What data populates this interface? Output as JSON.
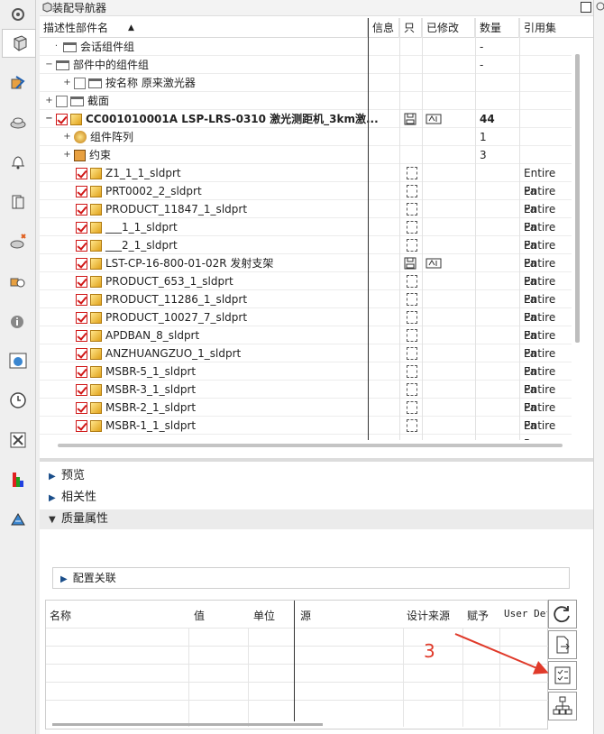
{
  "panel": {
    "title": "装配导航器"
  },
  "columns": {
    "name": "描述性部件名",
    "info": "信息",
    "readonly": "只",
    "modified": "已修改",
    "qty": "数量",
    "refset": "引用集"
  },
  "tree": [
    {
      "label": "会话组件组",
      "qty": "-"
    },
    {
      "label": "部件中的组件组",
      "qty": "-"
    },
    {
      "label": "按名称 原来激光器"
    },
    {
      "label": "截面"
    },
    {
      "label": "CC001010001A  LSP-LRS-0310  激光测距机_3km激...",
      "qty": "44"
    },
    {
      "label": "组件阵列",
      "qty": "1"
    },
    {
      "label": "约束",
      "qty": "3"
    },
    {
      "label": "Z1_1_1_sldprt",
      "ref": "Entire Pa"
    },
    {
      "label": "PRT0002_2_sldprt",
      "ref": "Entire Pa"
    },
    {
      "label": "PRODUCT_11847_1_sldprt",
      "ref": "Entire Pa"
    },
    {
      "label": "___1_1_sldprt",
      "ref": "Entire Pa"
    },
    {
      "label": "___2_1_sldprt",
      "ref": "Entire Pa"
    },
    {
      "label": "LST-CP-16-800-01-02R 发射支架",
      "ref": "Entire Pa"
    },
    {
      "label": "PRODUCT_653_1_sldprt",
      "ref": "Entire Pa"
    },
    {
      "label": "PRODUCT_11286_1_sldprt",
      "ref": "Entire Pa"
    },
    {
      "label": "PRODUCT_10027_7_sldprt",
      "ref": "Entire Pa"
    },
    {
      "label": "APDBAN_8_sldprt",
      "ref": "Entire Pa"
    },
    {
      "label": "ANZHUANGZUO_1_sldprt",
      "ref": "Entire Pa"
    },
    {
      "label": "MSBR-5_1_sldprt",
      "ref": "Entire Pa"
    },
    {
      "label": "MSBR-3_1_sldprt",
      "ref": "Entire Pa"
    },
    {
      "label": "MSBR-2_1_sldprt",
      "ref": "Entire Pa"
    },
    {
      "label": "MSBR-1_1_sldprt",
      "ref": "Entire Pa"
    }
  ],
  "sections": {
    "preview": "预览",
    "dependency": "相关性",
    "quality": "质量属性"
  },
  "config": {
    "label": "配置关联"
  },
  "qgrid": {
    "name": "名称",
    "value": "值",
    "unit": "单位",
    "source": "源",
    "design_source": "设计来源",
    "assign": "赋予",
    "user_def": "User Def"
  },
  "annotation": {
    "number": "3",
    "color": "#e03a2a"
  }
}
